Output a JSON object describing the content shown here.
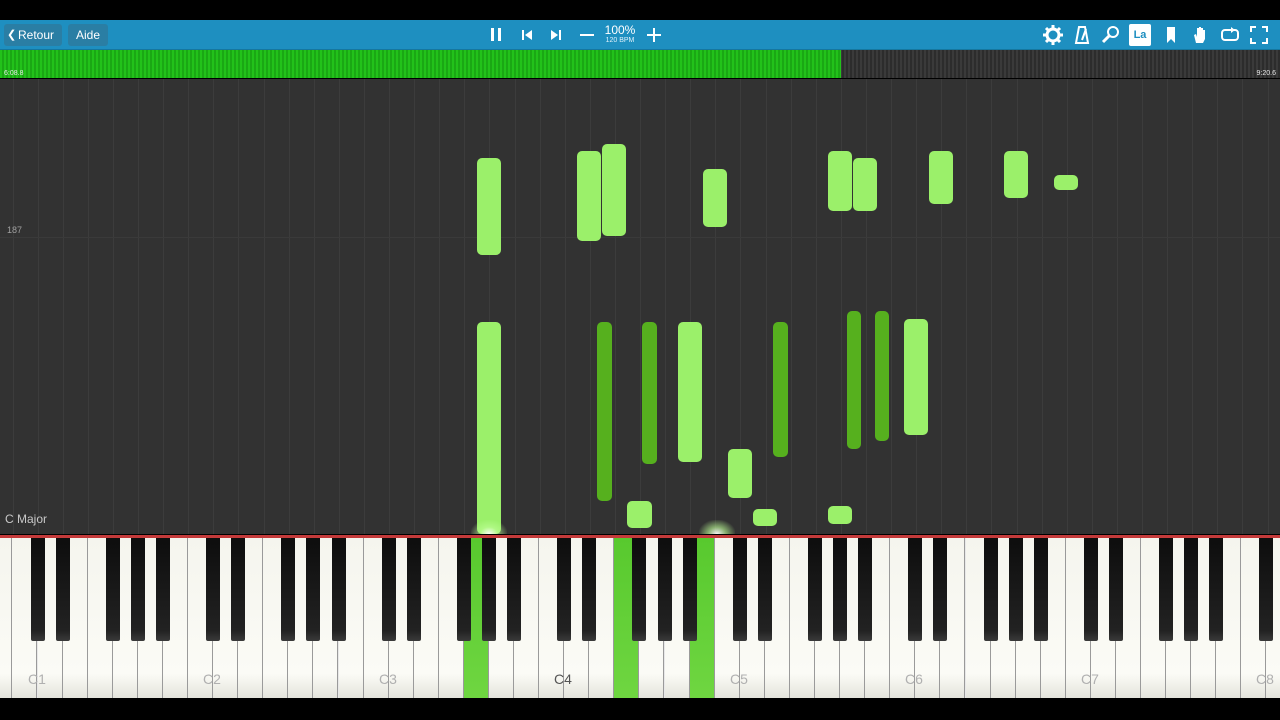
{
  "toolbar": {
    "back_label": "Retour",
    "help_label": "Aide",
    "zoom": "100%",
    "bpm": "120 BPM",
    "icons": [
      "pause-icon",
      "skip-back-icon",
      "skip-forward-icon",
      "minus-icon",
      "plus-icon",
      "gear-icon",
      "metronome-icon",
      "search-icon",
      "label-icon",
      "bookmark-icon",
      "hand-icon",
      "loop-icon",
      "fullscreen-icon"
    ],
    "label_icon_text": "La"
  },
  "progress": {
    "elapsed": "6:08.8",
    "total": "9:20.6",
    "fraction": 0.657,
    "colors": {
      "fill": "#22c21a",
      "track": "#333333"
    }
  },
  "roll": {
    "measure_number": "187",
    "key_signature": "C Major",
    "colors": {
      "background": "#323232",
      "light_note": "#9bf06a",
      "dark_note": "#56b01e"
    }
  },
  "keyboard": {
    "octave_labels": [
      "C1",
      "C2",
      "C3",
      "C4",
      "C5",
      "C6",
      "C7",
      "C8"
    ]
  }
}
